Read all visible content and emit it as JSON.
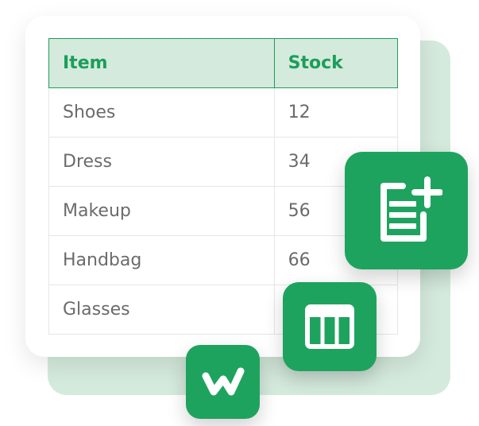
{
  "table": {
    "headers": {
      "item": "Item",
      "stock": "Stock"
    },
    "rows": [
      {
        "item": "Shoes",
        "stock": "12"
      },
      {
        "item": "Dress",
        "stock": "34"
      },
      {
        "item": "Makeup",
        "stock": "56"
      },
      {
        "item": "Handbag",
        "stock": "66"
      },
      {
        "item": "Glasses",
        "stock": ""
      }
    ]
  },
  "icons": {
    "report": "add-report-icon",
    "table": "table-layout-icon",
    "logo": "w-logo-icon"
  },
  "colors": {
    "accent": "#1ea35f",
    "header_bg": "#d4eadc",
    "header_text": "#1c9e5a",
    "body_text": "#6b6b6b"
  }
}
